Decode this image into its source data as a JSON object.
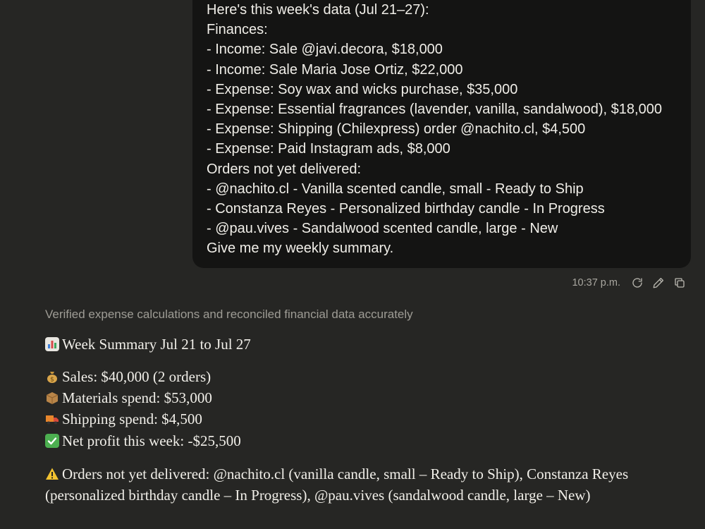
{
  "user_message": {
    "lines": [
      "Here's this week's data (Jul 21–27):",
      "Finances:",
      "- Income: Sale @javi.decora, $18,000",
      "- Income: Sale Maria Jose Ortiz, $22,000",
      "- Expense: Soy wax and wicks purchase, $35,000",
      "- Expense: Essential fragrances (lavender, vanilla, sandalwood), $18,000",
      "- Expense: Shipping (Chilexpress) order @nachito.cl, $4,500",
      "- Expense: Paid Instagram ads, $8,000",
      "Orders not yet delivered:",
      "- @nachito.cl - Vanilla scented candle, small - Ready to Ship",
      "- Constanza Reyes - Personalized birthday candle - In Progress",
      "- @pau.vives - Sandalwood scented candle, large - New",
      "Give me my weekly summary."
    ],
    "timestamp": "10:37 p.m.",
    "actions": [
      {
        "icon": "retry-icon"
      },
      {
        "icon": "edit-icon"
      },
      {
        "icon": "copy-icon"
      }
    ]
  },
  "assistant": {
    "thinking_summary": "Verified expense calculations and reconciled financial data accurately",
    "title": "Week Summary Jul 21 to Jul 27",
    "title_icon": "bar-chart-emoji",
    "stats": [
      {
        "icon": "money-bag-emoji",
        "text": "Sales: $40,000 (2 orders)"
      },
      {
        "icon": "package-emoji",
        "text": "Materials spend: $53,000"
      },
      {
        "icon": "truck-emoji",
        "text": "Shipping spend: $4,500"
      },
      {
        "icon": "check-mark-emoji",
        "text": "Net profit this week: -$25,500"
      }
    ],
    "orders_icon": "warning-emoji",
    "orders_text": "Orders not yet delivered: @nachito.cl (vanilla candle, small – Ready to Ship), Constanza Reyes (personalized birthday candle – In Progress), @pau.vives (sandalwood candle, large – New)"
  },
  "colors": {
    "background": "#262624",
    "user_bubble": "#141413",
    "text": "#f1efe9",
    "muted_text": "#9e9c95"
  }
}
